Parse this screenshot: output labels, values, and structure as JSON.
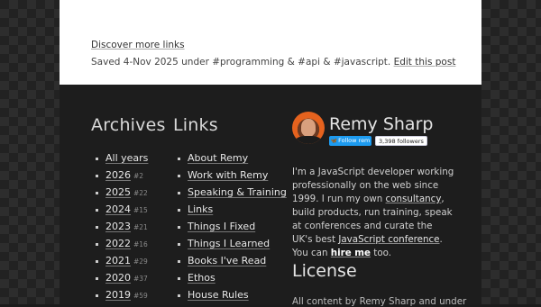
{
  "post_footer": {
    "discover_link": "Discover more links",
    "saved_prefix": "Saved 4-Nov 2025 under #programming & #api & #javascript.",
    "edit_link": "Edit this post"
  },
  "archives": {
    "title": "Archives",
    "items": [
      {
        "label": "All years",
        "count": ""
      },
      {
        "label": "2026",
        "count": "#2"
      },
      {
        "label": "2025",
        "count": "#22"
      },
      {
        "label": "2024",
        "count": "#15"
      },
      {
        "label": "2023",
        "count": "#21"
      },
      {
        "label": "2022",
        "count": "#16"
      },
      {
        "label": "2021",
        "count": "#29"
      },
      {
        "label": "2020",
        "count": "#37"
      },
      {
        "label": "2019",
        "count": "#59"
      }
    ]
  },
  "links": {
    "title": "Links",
    "items": [
      {
        "label": "About Remy"
      },
      {
        "label": "Work with Remy"
      },
      {
        "label": "Speaking & Training"
      },
      {
        "label": "Links"
      },
      {
        "label": "Things I Fixed"
      },
      {
        "label": "Things I Learned"
      },
      {
        "label": "Books I've Read"
      },
      {
        "label": "Ethos"
      },
      {
        "label": "House Rules"
      }
    ]
  },
  "author": {
    "name": "Remy Sharp",
    "follow_label": "Follow rem",
    "followers": "3,398 followers",
    "bio_1": "I'm a JavaScript developer working professionally on the web since 1999. I run my own ",
    "bio_consultancy": "consultancy",
    "bio_2": ", build products, run training, speak at conferences and curate the UK's best ",
    "bio_conference": "JavaScript conference",
    "bio_3": ". You can ",
    "bio_hire": "hire me",
    "bio_4": " too."
  },
  "license": {
    "title": "License",
    "text": "All content by Remy Sharp and under"
  }
}
